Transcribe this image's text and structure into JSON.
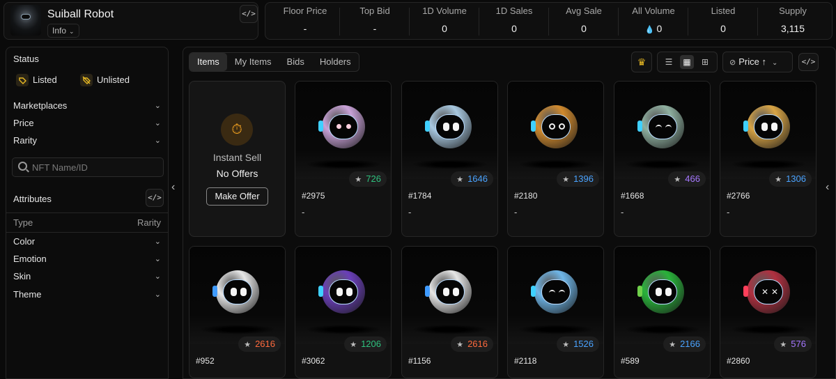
{
  "collection": {
    "title": "Suiball Robot",
    "info_label": "Info",
    "code_icon": "code-icon"
  },
  "stats": [
    {
      "label": "Floor Price",
      "value": "-"
    },
    {
      "label": "Top Bid",
      "value": "-"
    },
    {
      "label": "1D Volume",
      "value": "0"
    },
    {
      "label": "1D Sales",
      "value": "0"
    },
    {
      "label": "Avg Sale",
      "value": "0"
    },
    {
      "label": "All Volume",
      "value": "0",
      "icon": "sui-drop-icon"
    },
    {
      "label": "Listed",
      "value": "0"
    },
    {
      "label": "Supply",
      "value": "3,115"
    }
  ],
  "sidebar": {
    "status_title": "Status",
    "status_options": [
      {
        "label": "Listed",
        "icon": "tag-icon"
      },
      {
        "label": "Unlisted",
        "icon": "tag-off-icon"
      }
    ],
    "filters": [
      {
        "label": "Marketplaces"
      },
      {
        "label": "Price"
      },
      {
        "label": "Rarity"
      }
    ],
    "search_placeholder": "NFT Name/ID",
    "attributes_title": "Attributes",
    "attr_header_type": "Type",
    "attr_header_rarity": "Rarity",
    "attributes": [
      {
        "label": "Color"
      },
      {
        "label": "Emotion"
      },
      {
        "label": "Skin"
      },
      {
        "label": "Theme"
      }
    ]
  },
  "main": {
    "tabs": [
      {
        "label": "Items",
        "active": true
      },
      {
        "label": "My Items"
      },
      {
        "label": "Bids"
      },
      {
        "label": "Holders"
      }
    ],
    "sort_label": "Price ↑",
    "instant_sell": {
      "title": "Instant Sell",
      "subtitle": "No Offers",
      "button": "Make Offer"
    },
    "items": [
      {
        "id": "#2975",
        "rank": "726",
        "rank_color": "#2ec27e",
        "price": "-",
        "body": "#c9a2d8",
        "ear": "#3fd0ff"
      },
      {
        "id": "#1784",
        "rank": "1646",
        "rank_color": "#4aa3ff",
        "price": "-",
        "body": "#a8c8e0",
        "ear": "#3fd0ff"
      },
      {
        "id": "#2180",
        "rank": "1396",
        "rank_color": "#4aa3ff",
        "price": "-",
        "body": "#d08a2e",
        "ear": "#3fd0ff"
      },
      {
        "id": "#1668",
        "rank": "466",
        "rank_color": "#a678ff",
        "price": "-",
        "body": "#8fb0a0",
        "ear": "#3fd0ff"
      },
      {
        "id": "#2766",
        "rank": "1306",
        "rank_color": "#4aa3ff",
        "price": "-",
        "body": "#d8a445",
        "ear": "#3fd0ff"
      },
      {
        "id": "#952",
        "rank": "2616",
        "rank_color": "#ff6a3d",
        "body": "#e6e6e6",
        "ear": "#3f9bff"
      },
      {
        "id": "#3062",
        "rank": "1206",
        "rank_color": "#2ec27e",
        "body": "#6a3fb8",
        "ear": "#3fd0ff"
      },
      {
        "id": "#1156",
        "rank": "2616",
        "rank_color": "#ff6a3d",
        "body": "#e6e6e6",
        "ear": "#3f9bff"
      },
      {
        "id": "#2118",
        "rank": "1526",
        "rank_color": "#4aa3ff",
        "body": "#6fb6e8",
        "ear": "#3fd0ff"
      },
      {
        "id": "#589",
        "rank": "2166",
        "rank_color": "#4aa3ff",
        "body": "#29b23a",
        "ear": "#6fd04a"
      },
      {
        "id": "#2860",
        "rank": "576",
        "rank_color": "#a678ff",
        "body": "#b03040",
        "ear": "#ff3f5a"
      }
    ]
  }
}
